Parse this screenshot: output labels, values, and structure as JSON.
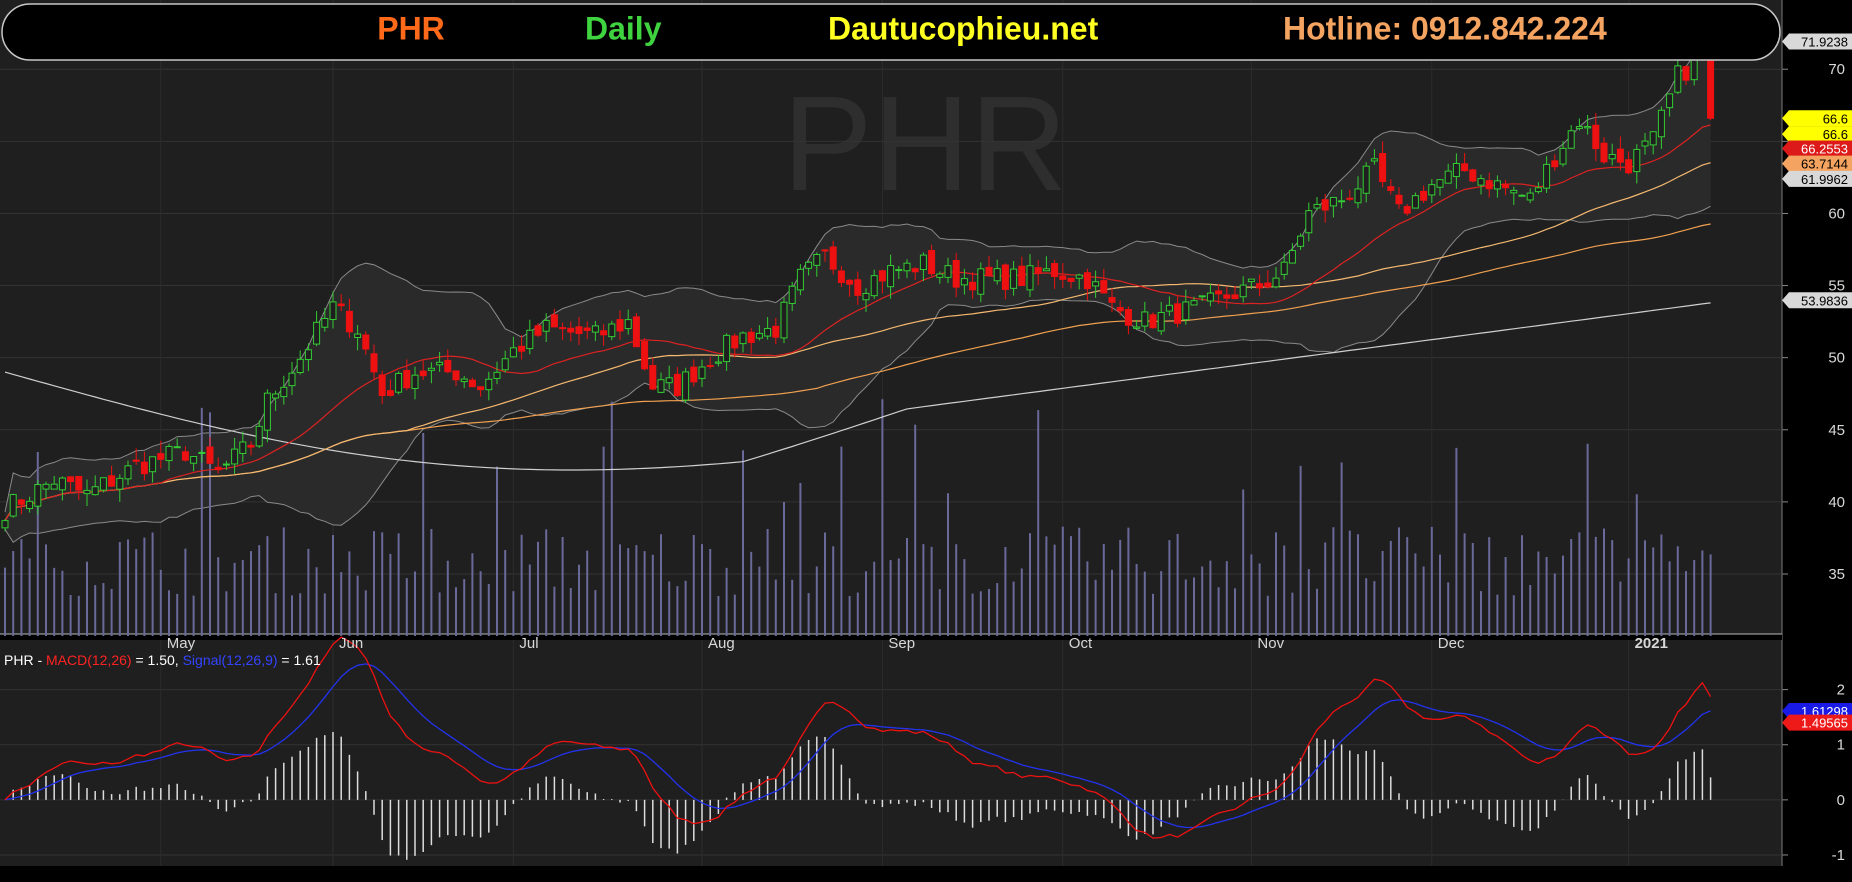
{
  "header": {
    "ticker": "PHR",
    "period": "Daily",
    "site": "Dautucophieu.net",
    "hotline": "Hotline: 0912.842.224",
    "colors": {
      "ticker": "#ff6a1a",
      "period": "#3fd43f",
      "site": "#ffff22",
      "hotline": "#f4a460"
    }
  },
  "watermark": "PHR",
  "price_badges": [
    {
      "label": "71.9238",
      "value": 71.9238,
      "bg": "#d8d8d8",
      "fg": "#000000"
    },
    {
      "label": "66.6",
      "value": 66.6,
      "bg": "#ffff00",
      "fg": "#000000"
    },
    {
      "label": "66.6",
      "value": 65.5,
      "bg": "#ffff00",
      "fg": "#000000"
    },
    {
      "label": "66.2553",
      "value": 64.5,
      "bg": "#dd1a1a",
      "fg": "#ffffff"
    },
    {
      "label": "63.7144",
      "value": 63.45,
      "bg": "#f4a460",
      "fg": "#000000"
    },
    {
      "label": "61.9962",
      "value": 62.4,
      "bg": "#d8d8d8",
      "fg": "#000000"
    },
    {
      "label": "53.9836",
      "value": 53.98,
      "bg": "#d8d8d8",
      "fg": "#000000"
    }
  ],
  "macd_legend": {
    "prefix": "PHR - ",
    "macd_label": "MACD(12,26)",
    "macd_value": " = 1.50, ",
    "signal_label": "Signal(12,26,9)",
    "signal_value": " = 1.61"
  },
  "macd_badges": [
    {
      "label": "1.61298",
      "value": 1.61298,
      "bg": "#1a1ae6",
      "fg": "#ffffff"
    },
    {
      "label": "1.49565",
      "value": 1.4,
      "bg": "#ee1a1a",
      "fg": "#ffffff"
    }
  ],
  "chart_data": [
    {
      "type": "candlestick",
      "title": "PHR Daily",
      "price_ticks": [
        35,
        40,
        45,
        50,
        55,
        60,
        65,
        70
      ],
      "ylim": [
        30.7,
        74.8
      ],
      "months": [
        {
          "label": "May",
          "index": 19
        },
        {
          "label": "Jun",
          "index": 40
        },
        {
          "label": "Jul",
          "index": 62
        },
        {
          "label": "Aug",
          "index": 85
        },
        {
          "label": "Sep",
          "index": 107
        },
        {
          "label": "Oct",
          "index": 129
        },
        {
          "label": "Nov",
          "index": 152
        },
        {
          "label": "Dec",
          "index": 174
        },
        {
          "label": "2021",
          "index": 198,
          "bold": true
        }
      ],
      "close_anchors": [
        [
          0,
          39.5
        ],
        [
          6,
          41.5
        ],
        [
          10,
          40.5
        ],
        [
          16,
          42.5
        ],
        [
          22,
          43.5
        ],
        [
          26,
          42
        ],
        [
          30,
          44
        ],
        [
          32,
          47
        ],
        [
          36,
          50
        ],
        [
          40,
          53.5
        ],
        [
          43,
          52
        ],
        [
          46,
          47.5
        ],
        [
          50,
          49
        ],
        [
          55,
          49
        ],
        [
          58,
          48
        ],
        [
          62,
          50.5
        ],
        [
          66,
          52
        ],
        [
          72,
          51.5
        ],
        [
          76,
          52.5
        ],
        [
          79,
          48
        ],
        [
          82,
          48
        ],
        [
          86,
          50
        ],
        [
          90,
          51.5
        ],
        [
          94,
          52
        ],
        [
          97,
          55.5
        ],
        [
          100,
          57
        ],
        [
          104,
          55
        ],
        [
          108,
          56
        ],
        [
          112,
          56.5
        ],
        [
          116,
          55.5
        ],
        [
          120,
          55.5
        ],
        [
          124,
          55.5
        ],
        [
          128,
          56
        ],
        [
          132,
          55.5
        ],
        [
          135,
          53.5
        ],
        [
          139,
          52.5
        ],
        [
          142,
          53
        ],
        [
          146,
          53.5
        ],
        [
          150,
          54.5
        ],
        [
          153,
          55
        ],
        [
          156,
          56
        ],
        [
          159,
          60
        ],
        [
          163,
          61
        ],
        [
          167,
          63
        ],
        [
          170,
          60
        ],
        [
          174,
          62
        ],
        [
          178,
          63
        ],
        [
          182,
          62
        ],
        [
          186,
          61
        ],
        [
          189,
          64
        ],
        [
          192,
          66.5
        ],
        [
          195,
          64
        ],
        [
          198,
          63.5
        ],
        [
          201,
          65
        ],
        [
          204,
          69.5
        ],
        [
          207,
          71
        ],
        [
          208,
          66.6
        ]
      ],
      "volume": {
        "max_reference": 2000000
      }
    },
    {
      "type": "line",
      "title": "MACD",
      "macd_ticks": [
        -1,
        0,
        1,
        2
      ],
      "ylim": [
        -1.2,
        2.9
      ],
      "series": [
        {
          "name": "MACD(12,26)",
          "color": "#ee1111",
          "last": 1.5
        },
        {
          "name": "Signal(12,26,9)",
          "color": "#2233ee",
          "last": 1.61
        }
      ]
    }
  ]
}
